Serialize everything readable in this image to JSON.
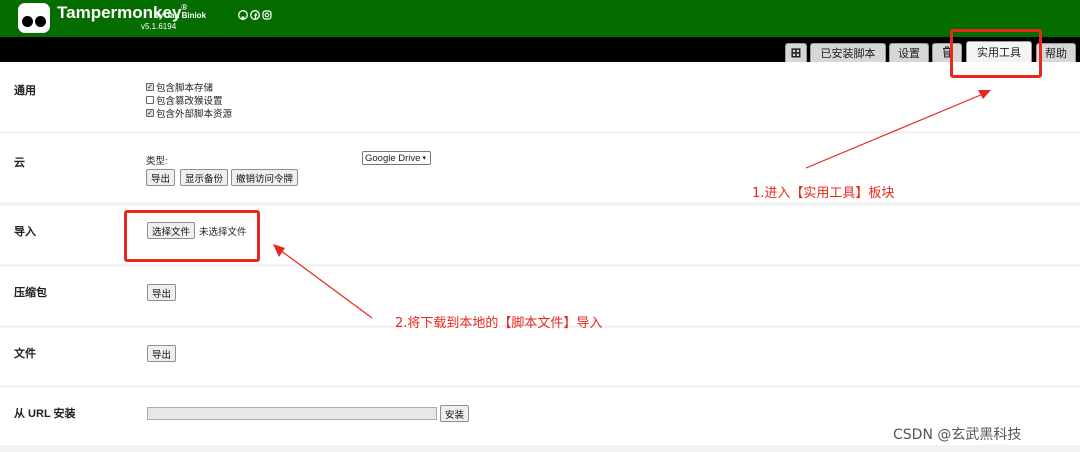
{
  "header": {
    "brand": "Tampermonkey",
    "registered": "®",
    "author": "by Jan Biniok",
    "version": "v5.1.6194",
    "social_icons": [
      "github-icon",
      "facebook-icon",
      "instagram-icon"
    ]
  },
  "tabs": {
    "add_icon": "⊞",
    "installed": "已安装脚本",
    "settings": "设置",
    "trash_icon": "trash-icon",
    "utilities": "实用工具",
    "help": "帮助"
  },
  "general": {
    "title": "通用",
    "options": [
      {
        "label": "包含脚本存储",
        "checked": true
      },
      {
        "label": "包含篡改猴设置",
        "checked": false
      },
      {
        "label": "包含外部脚本资源",
        "checked": true
      }
    ]
  },
  "cloud": {
    "title": "云",
    "type_label": "类型:",
    "type_value": "Google Drive",
    "export_btn": "导出",
    "show_backups_btn": "显示备份",
    "revoke_btn": "撤销访问令牌"
  },
  "import": {
    "title": "导入",
    "choose_btn": "选择文件",
    "no_file": "未选择文件"
  },
  "zip": {
    "title": "压缩包",
    "export_btn": "导出"
  },
  "file": {
    "title": "文件",
    "export_btn": "导出"
  },
  "url": {
    "title": "从 URL 安装",
    "install_btn": "安装",
    "value": ""
  },
  "annotations": {
    "step1": "1.进入【实用工具】板块",
    "step2": "2.将下载到本地的【脚本文件】导入"
  },
  "watermark": "CSDN @玄武黑科技",
  "colors": {
    "header_bg": "#056d00",
    "annotation_red": "#e8281e"
  }
}
